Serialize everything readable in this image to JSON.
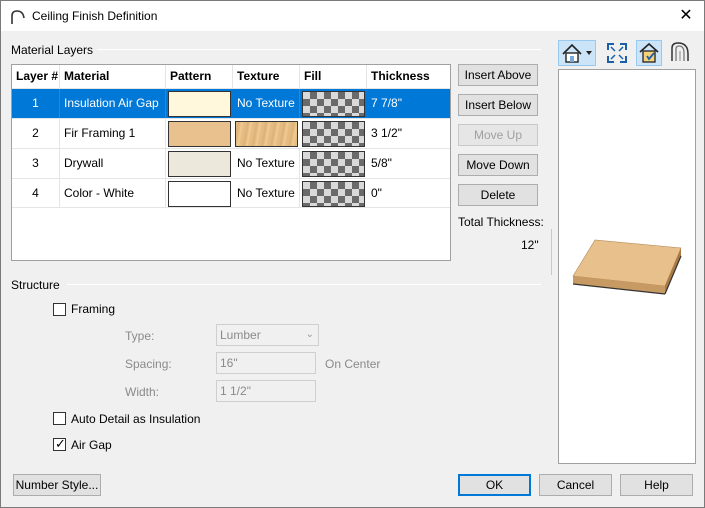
{
  "window": {
    "title": "Ceiling Finish Definition",
    "close_glyph": "✕"
  },
  "material_layers": {
    "group_label": "Material Layers",
    "columns": [
      "Layer #",
      "Material",
      "Pattern",
      "Texture",
      "Fill",
      "Thickness"
    ],
    "rows": [
      {
        "layer": "1",
        "material": "Insulation Air Gap",
        "pattern_color": "#fff8dc",
        "texture": "No Texture",
        "thickness": "7 7/8\"",
        "selected": true
      },
      {
        "layer": "2",
        "material": "Fir Framing 1",
        "pattern_color": "#e9c18e",
        "texture": "",
        "texture_icon": "wood-texture",
        "thickness": "3 1/2\""
      },
      {
        "layer": "3",
        "material": "Drywall",
        "pattern_color": "#ede8dc",
        "texture": "No Texture",
        "thickness": "5/8\""
      },
      {
        "layer": "4",
        "material": "Color - White",
        "pattern_color": "#ffffff",
        "texture": "No Texture",
        "thickness": "0\""
      }
    ]
  },
  "side_buttons": {
    "insert_above": "Insert Above",
    "insert_below": "Insert Below",
    "move_up": "Move Up",
    "move_down": "Move Down",
    "delete": "Delete"
  },
  "total_thickness": {
    "label": "Total Thickness:",
    "value": "12\""
  },
  "structure": {
    "group_label": "Structure",
    "framing_label": "Framing",
    "framing_checked": false,
    "type_label": "Type:",
    "type_value": "Lumber",
    "spacing_label": "Spacing:",
    "spacing_value": "16\"",
    "spacing_suffix": "On Center",
    "width_label": "Width:",
    "width_value": "1 1/2\"",
    "auto_detail_label": "Auto Detail as Insulation",
    "auto_detail_checked": false,
    "air_gap_label": "Air Gap",
    "air_gap_checked": true
  },
  "toolbar_icons": [
    "view-house-icon",
    "fit-view-icon",
    "render-toggle-icon",
    "section-view-icon"
  ],
  "footer": {
    "number_style": "Number Style...",
    "ok": "OK",
    "cancel": "Cancel",
    "help": "Help"
  },
  "colors": {
    "selection": "#0078d7",
    "default_button_border": "#0078d7",
    "preview_box": "#e8c08c"
  }
}
